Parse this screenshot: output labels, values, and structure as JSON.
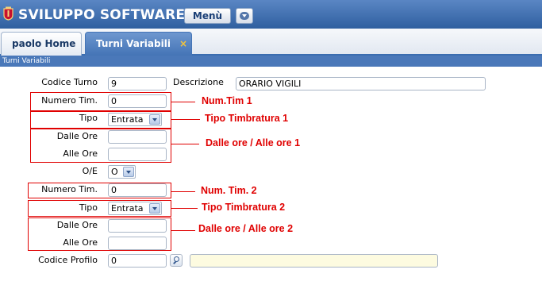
{
  "header": {
    "brand": "SVILUPPO SOFTWARE",
    "menu_label": "Menù",
    "logo_icon": "coat-of-arms-icon",
    "dropdown_icon": "chevron-down-icon"
  },
  "tabs": [
    {
      "label": "paolo Home",
      "active": false
    },
    {
      "label": "Turni Variabili",
      "active": true,
      "close": "×"
    }
  ],
  "subbar": {
    "title": "Turni Variabili"
  },
  "form": {
    "codice_turno": {
      "label": "Codice Turno",
      "value": "9"
    },
    "descrizione": {
      "label": "Descrizione",
      "value": "ORARIO VIGILI"
    },
    "group1": {
      "numero_tim": {
        "label": "Numero Tim.",
        "value": "0"
      },
      "tipo": {
        "label": "Tipo",
        "value": "Entrata"
      },
      "dalle_ore": {
        "label": "Dalle Ore",
        "value": ""
      },
      "alle_ore": {
        "label": "Alle Ore",
        "value": ""
      }
    },
    "oe": {
      "label": "O/E",
      "value": "O"
    },
    "group2": {
      "numero_tim": {
        "label": "Numero Tim.",
        "value": "0"
      },
      "tipo": {
        "label": "Tipo",
        "value": "Entrata"
      },
      "dalle_ore": {
        "label": "Dalle Ore",
        "value": ""
      },
      "alle_ore": {
        "label": "Alle Ore",
        "value": ""
      }
    },
    "codice_profilo": {
      "label": "Codice Profilo",
      "value": "0",
      "description": "",
      "search_icon": "search-icon"
    }
  },
  "annotations": {
    "num_tim_1": "Num.Tim 1",
    "tipo_timbratura_1": "Tipo Timbratura 1",
    "dalle_alle_1": "Dalle ore / Alle ore 1",
    "num_tim_2": "Num. Tim. 2",
    "tipo_timbratura_2": "Tipo Timbratura 2",
    "dalle_alle_2": "Dalle ore / Alle ore 2",
    "color": "#e00000"
  }
}
